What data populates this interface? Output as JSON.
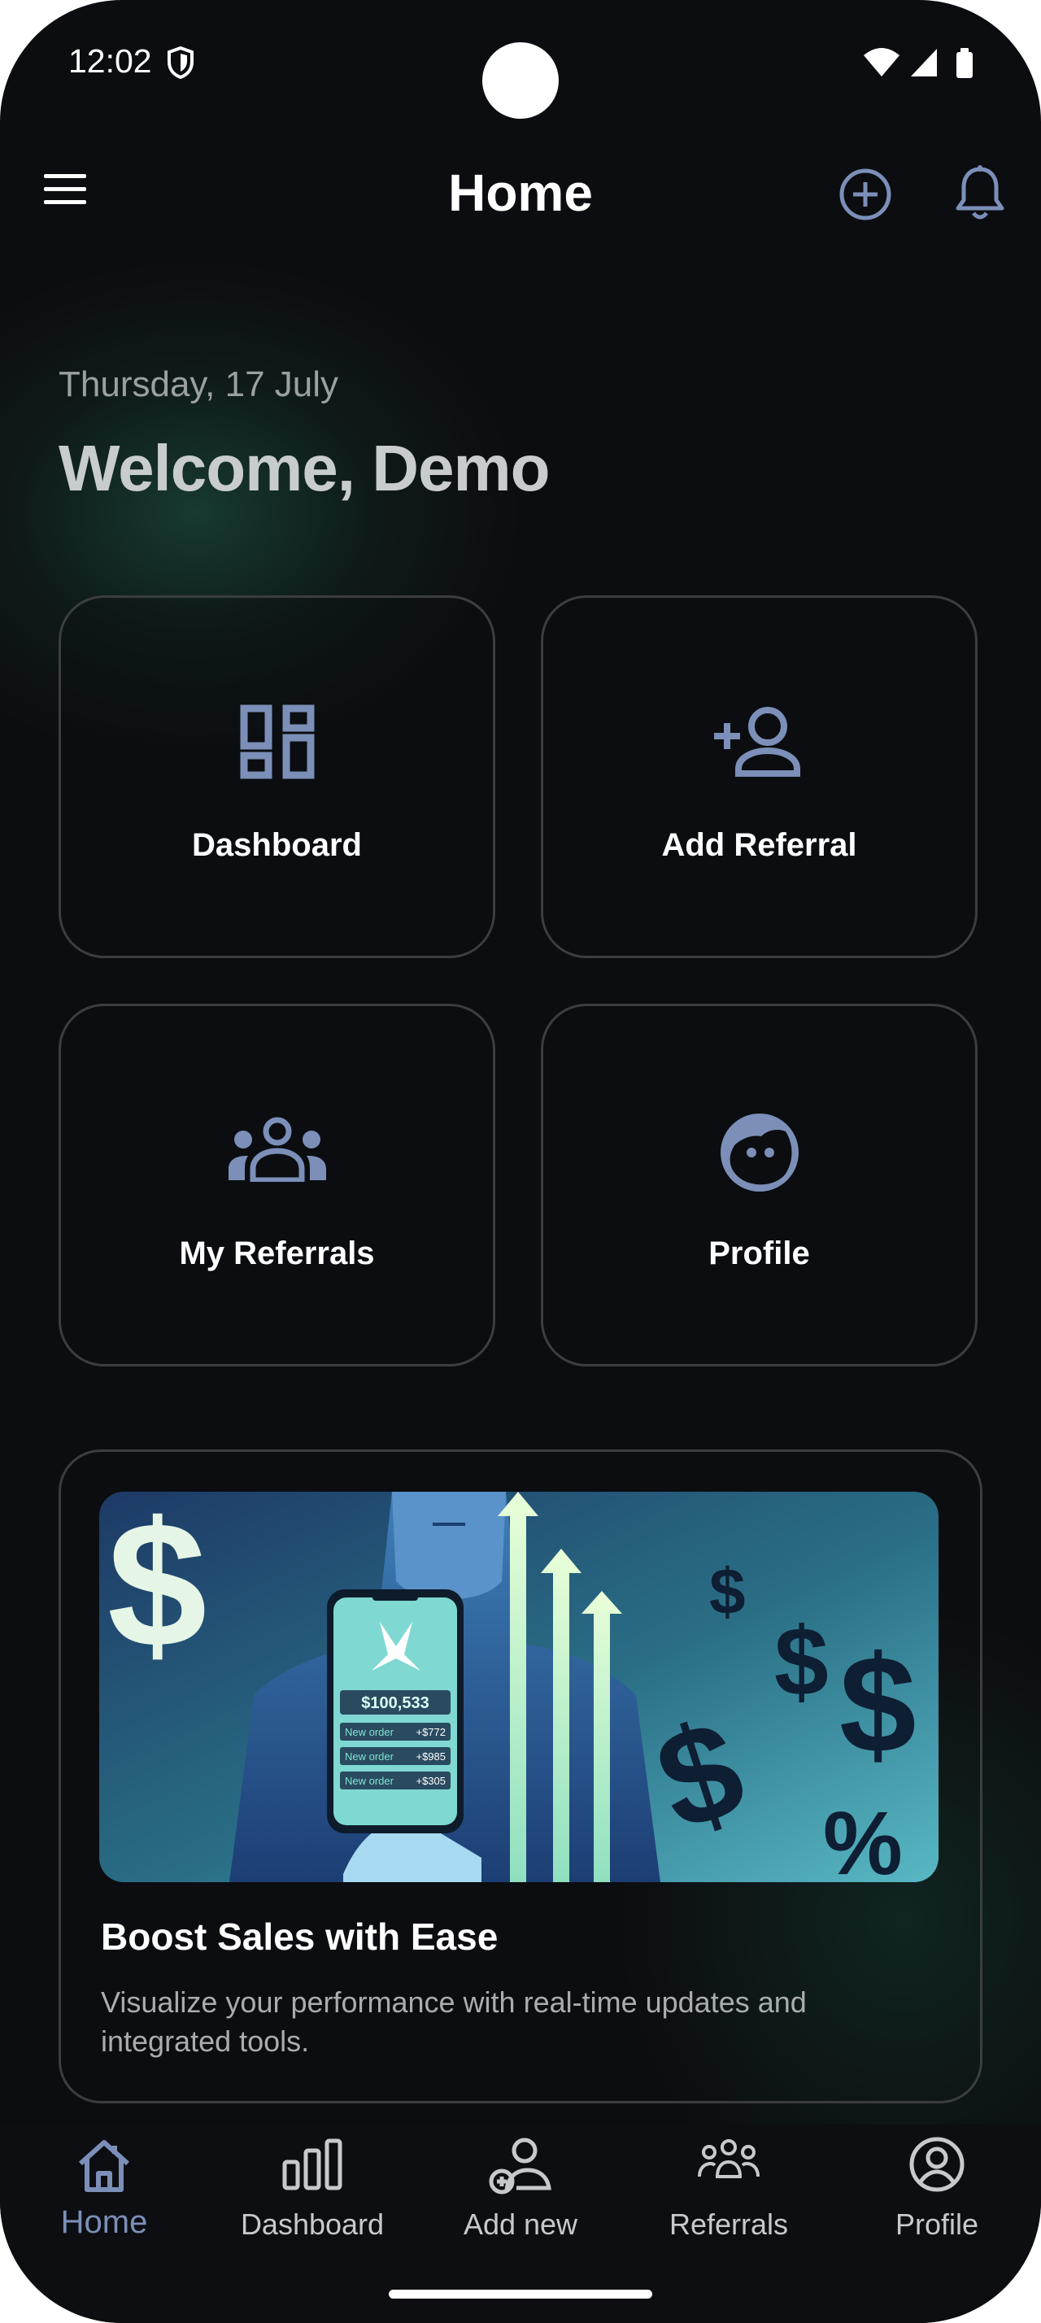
{
  "status_bar": {
    "time": "12:02"
  },
  "app_bar": {
    "title": "Home",
    "menu_icon": "menu-icon",
    "add_icon": "add-circle-icon",
    "bell_icon": "bell-icon"
  },
  "greeting": {
    "date": "Thursday, 17 July",
    "welcome": "Welcome, Demo"
  },
  "tiles": [
    {
      "label": "Dashboard",
      "icon": "dashboard-icon"
    },
    {
      "label": "Add Referral",
      "icon": "add-person-icon"
    },
    {
      "label": "My Referrals",
      "icon": "group-icon"
    },
    {
      "label": "Profile",
      "icon": "face-icon"
    }
  ],
  "banner": {
    "title": "Boost Sales with Ease",
    "description": "Visualize your performance with real-time updates and integrated tools.",
    "image": {
      "amount": "$100,533",
      "orders": [
        {
          "label": "New order",
          "value": "+$772"
        },
        {
          "label": "New order",
          "value": "+$985"
        },
        {
          "label": "New order",
          "value": "+$305"
        }
      ]
    }
  },
  "bottom_nav": [
    {
      "label": "Home",
      "icon": "home-icon",
      "active": true
    },
    {
      "label": "Dashboard",
      "icon": "bar-chart-icon",
      "active": false
    },
    {
      "label": "Add new",
      "icon": "add-person-icon",
      "active": false
    },
    {
      "label": "Referrals",
      "icon": "group-icon",
      "active": false
    },
    {
      "label": "Profile",
      "icon": "account-circle-icon",
      "active": false
    }
  ],
  "colors": {
    "background": "#0c0d10",
    "accent": "#7b8fb8",
    "tile_border": "#3b3d41",
    "text": "#ffffff",
    "muted": "#9aa0a3"
  }
}
